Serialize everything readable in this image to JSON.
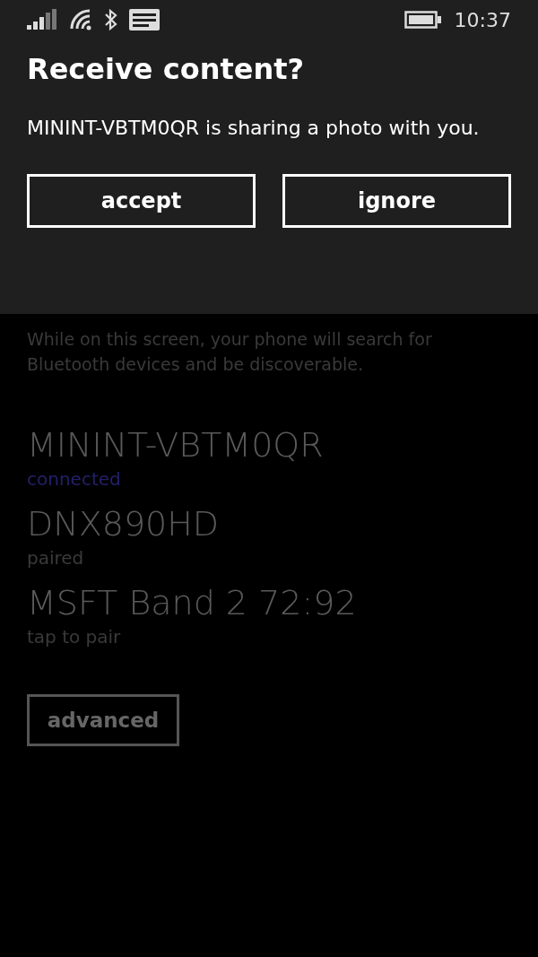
{
  "status_bar": {
    "time": "10:37"
  },
  "dialog": {
    "title": "Receive content?",
    "message": "MININT-VBTM0QR is sharing a photo with you.",
    "buttons": [
      "accept",
      "ignore"
    ]
  },
  "description": "While on this screen, your phone will search for Bluetooth devices and be discoverable.",
  "devices": [
    {
      "name": "MININT-VBTM0QR",
      "status": "connected",
      "connected": true
    },
    {
      "name": "DNX890HD",
      "status": "paired",
      "connected": false
    },
    {
      "name": "MSFT Band 2 72:92",
      "status": "tap to pair",
      "connected": false
    }
  ],
  "advanced_button": "advanced"
}
